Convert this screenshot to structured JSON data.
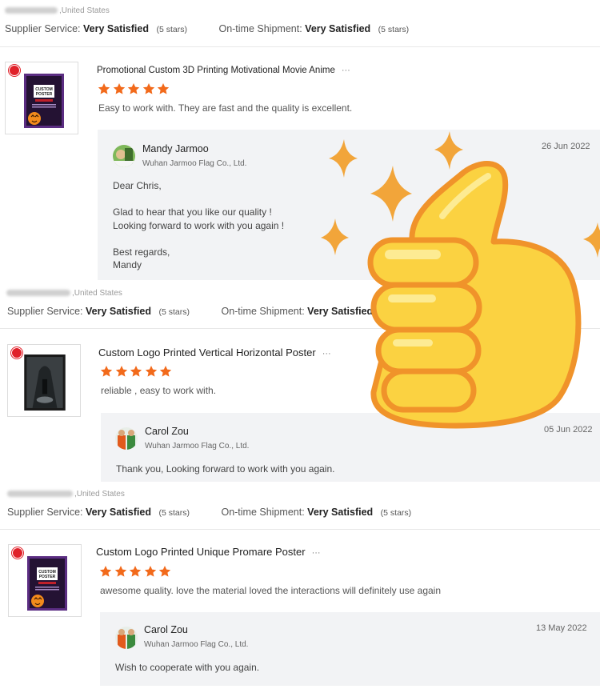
{
  "reviews": [
    {
      "reviewer": ",United States",
      "supplier_label": "Supplier Service:",
      "supplier_value": "Very Satisfied",
      "supplier_stars": "(5 stars)",
      "shipment_label": "On-time Shipment:",
      "shipment_value": "Very Satisfied",
      "shipment_stars": "(5 stars)",
      "product_title": "Promotional Custom 3D Printing Motivational Movie Anime",
      "more": "···",
      "stars": 5,
      "comment": "Easy to work with. They are fast and the quality is excellent.",
      "reply": {
        "name": "Mandy Jarmoo",
        "company": "Wuhan Jarmoo Flag Co., Ltd.",
        "date": "26 Jun 2022",
        "text": "Dear Chris,\n\nGlad to hear that you like our quality !\nLooking forward to work with you again !\n\nBest regards,\nMandy"
      }
    },
    {
      "reviewer": ",United States",
      "supplier_label": "Supplier Service:",
      "supplier_value": "Very Satisfied",
      "supplier_stars": "(5 stars)",
      "shipment_label": "On-time Shipment:",
      "shipment_value": "Very Satisfied",
      "shipment_stars": "",
      "product_title": "Custom Logo Printed Vertical Horizontal Poster",
      "more": "···",
      "stars": 5,
      "comment": "reliable , easy to work with.",
      "reply": {
        "name": "Carol Zou",
        "company": "Wuhan Jarmoo Flag Co., Ltd.",
        "date": "05 Jun 2022",
        "text": "Thank you, Looking forward to work with you again."
      }
    },
    {
      "reviewer": ",United States",
      "supplier_label": "Supplier Service:",
      "supplier_value": "Very Satisfied",
      "supplier_stars": "(5 stars)",
      "shipment_label": "On-time Shipment:",
      "shipment_value": "Very Satisfied",
      "shipment_stars": "(5 stars)",
      "product_title": "Custom Logo Printed Unique Promare Poster",
      "more": "···",
      "stars": 5,
      "comment": "awesome quality. love the material loved the interactions will definitely use again",
      "reply": {
        "name": "Carol Zou",
        "company": "Wuhan Jarmoo Flag Co., Ltd.",
        "date": "13 May 2022",
        "text": "Wish to cooperate with you again."
      }
    }
  ],
  "poster_text": {
    "line1": "CUSTOM",
    "line2": "POSTER"
  },
  "colors": {
    "star": "#f26a1b",
    "reply_bg": "#f2f3f5",
    "thumb_overlay": "#fbd241",
    "sparkle": "#f2a53a"
  }
}
